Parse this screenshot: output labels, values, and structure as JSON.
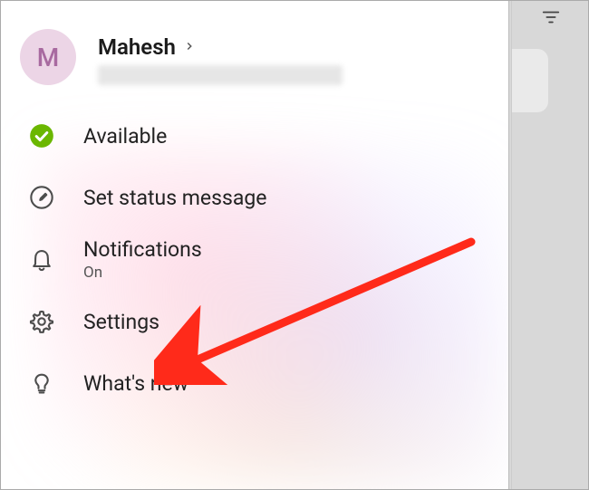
{
  "profile": {
    "avatar_initial": "M",
    "name": "Mahesh"
  },
  "menu": {
    "available": {
      "label": "Available"
    },
    "status_message": {
      "label": "Set status message"
    },
    "notifications": {
      "label": "Notifications",
      "sub": "On"
    },
    "settings": {
      "label": "Settings"
    },
    "whats_new": {
      "label": "What's new"
    }
  }
}
